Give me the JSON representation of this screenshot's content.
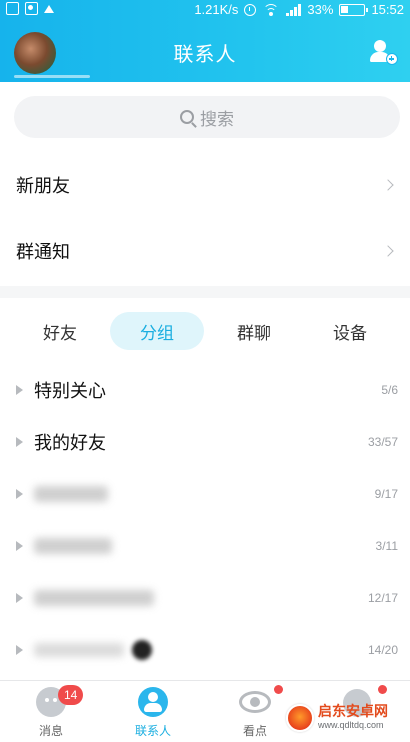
{
  "status_bar": {
    "speed": "1.21K/s",
    "battery": "33%",
    "time": "15:52"
  },
  "header": {
    "title": "联系人"
  },
  "search": {
    "placeholder": "搜索"
  },
  "rows": [
    {
      "label": "新朋友"
    },
    {
      "label": "群通知"
    }
  ],
  "segments": [
    {
      "label": "好友",
      "active": false
    },
    {
      "label": "分组",
      "active": true
    },
    {
      "label": "群聊",
      "active": false
    },
    {
      "label": "设备",
      "active": false
    }
  ],
  "groups": [
    {
      "name": "特别关心",
      "count": "5/6",
      "blurred": false
    },
    {
      "name": "我的好友",
      "count": "33/57",
      "blurred": false
    },
    {
      "name": "",
      "count": "9/17",
      "blurred": true
    },
    {
      "name": "",
      "count": "3/11",
      "blurred": true
    },
    {
      "name": "",
      "count": "12/17",
      "blurred": true
    },
    {
      "name": "",
      "count": "14/20",
      "blurred": true
    }
  ],
  "tabbar": {
    "items": [
      {
        "label": "消息",
        "badge": "14",
        "active": false
      },
      {
        "label": "联系人",
        "active": true
      },
      {
        "label": "看点",
        "active": false
      },
      {
        "label": "",
        "active": false
      }
    ]
  },
  "watermark": {
    "cn": "启东安卓网",
    "en": "www.qdltdq.com"
  },
  "colors": {
    "accent": "#1aaee0",
    "header_from": "#16b3ec",
    "header_to": "#2fd0f0",
    "badge": "#f04b4b"
  }
}
